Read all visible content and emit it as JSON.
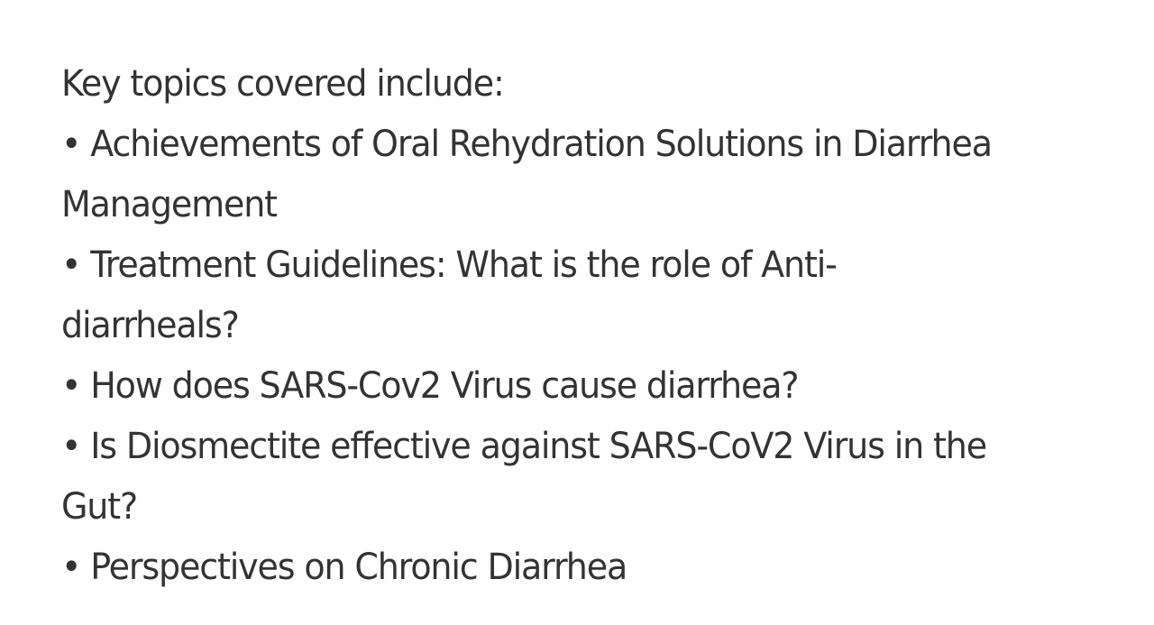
{
  "intro": "Key topics covered include:",
  "items": [
    [
      "• Achievements of Oral Rehydration Solutions in Diarrhea",
      "Management"
    ],
    [
      "• Treatment Guidelines: What is the role of Anti-",
      "diarrheals?"
    ],
    [
      "• How does SARS-Cov2 Virus cause diarrhea?"
    ],
    [
      "• Is Diosmectite effective against SARS-CoV2 Virus in the",
      "Gut?"
    ],
    [
      "• Perspectives on Chronic Diarrhea"
    ]
  ]
}
